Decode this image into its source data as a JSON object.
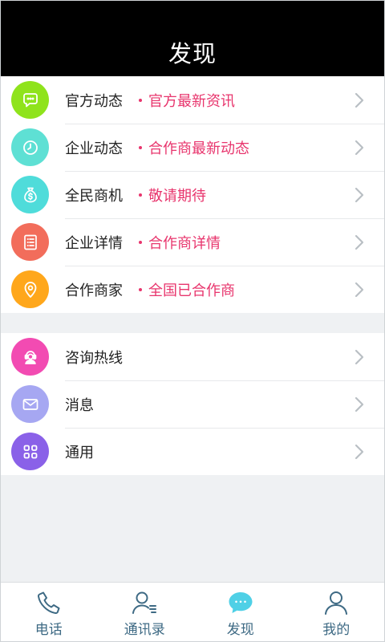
{
  "header": {
    "title": "发现"
  },
  "group1": [
    {
      "label": "官方动态",
      "sub": "官方最新资讯",
      "icon": "chat-bubble-icon",
      "color": "#8fe31c"
    },
    {
      "label": "企业动态",
      "sub": "合作商最新动态",
      "icon": "clock-icon",
      "color": "#5ee0d4"
    },
    {
      "label": "全民商机",
      "sub": "敬请期待",
      "icon": "money-bag-icon",
      "color": "#4fdcda"
    },
    {
      "label": "企业详情",
      "sub": "合作商详情",
      "icon": "document-list-icon",
      "color": "#f26d5b"
    },
    {
      "label": "合作商家",
      "sub": "全国已合作商",
      "icon": "location-pin-icon",
      "color": "#ffa71b"
    }
  ],
  "group2": [
    {
      "label": "咨询热线",
      "icon": "customer-service-icon",
      "color": "#f24bb2"
    },
    {
      "label": "消息",
      "icon": "envelope-icon",
      "color": "#a6a7f2"
    },
    {
      "label": "通用",
      "icon": "grid-icon",
      "color": "#8a61e8"
    }
  ],
  "tabbar": [
    {
      "label": "电话",
      "icon": "phone-icon"
    },
    {
      "label": "通讯录",
      "icon": "contacts-icon"
    },
    {
      "label": "发现",
      "icon": "discover-chat-icon"
    },
    {
      "label": "我的",
      "icon": "user-icon"
    }
  ],
  "colors": {
    "tabIcon": "#3e6a84",
    "tabIconActive": "#4fd0e6",
    "subtitle": "#e8356d"
  }
}
